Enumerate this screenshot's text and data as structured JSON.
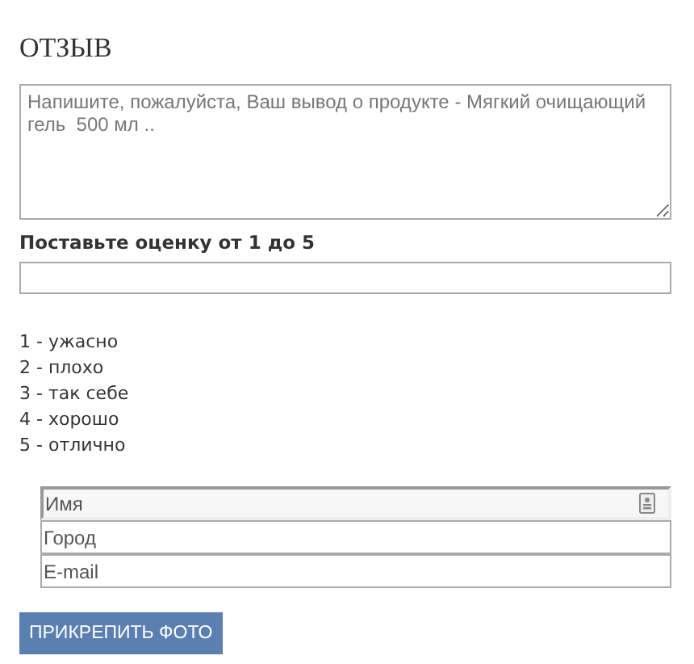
{
  "title": "ОТЗЫВ",
  "review": {
    "placeholder": "Напишите, пожалуйста, Ваш вывод о продукте - Мягкий очищающий гель  500 мл .."
  },
  "rating": {
    "label": "Поставьте оценку от 1 до 5"
  },
  "legend": [
    "1 - ужасно",
    "2 - плохо",
    "3 - так себе",
    "4 - хорошо",
    "5 - отлично"
  ],
  "contact_fields": [
    {
      "placeholder": "Имя",
      "kind": "autofill"
    },
    {
      "placeholder": "Город",
      "kind": "plain"
    },
    {
      "placeholder": "E-mail",
      "kind": "plain"
    }
  ],
  "attach_button": "ПРИКРЕПИТЬ ФОТО"
}
